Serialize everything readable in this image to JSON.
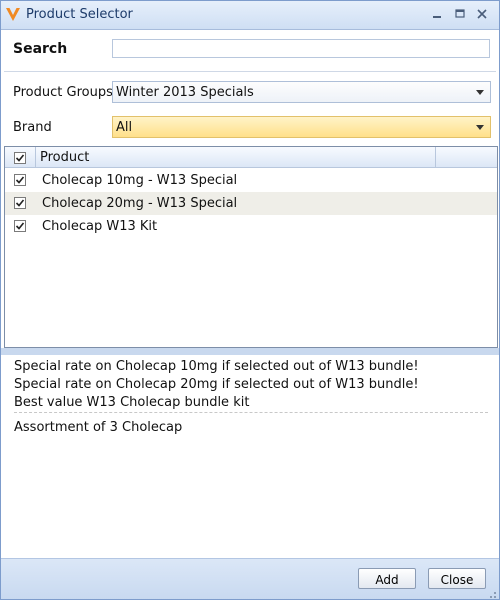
{
  "window": {
    "title": "Product Selector",
    "minimize_icon": "minimize-icon",
    "maximize_icon": "maximize-icon",
    "close_icon": "close-icon"
  },
  "search": {
    "label": "Search",
    "value": "",
    "placeholder": ""
  },
  "filters": {
    "product_groups": {
      "label": "Product Groups",
      "value": "Winter 2013 Specials"
    },
    "brand": {
      "label": "Brand",
      "value": "All"
    }
  },
  "grid": {
    "header": {
      "column_product": "Product",
      "all_checked": true
    },
    "rows": [
      {
        "label": "Cholecap 10mg - W13 Special",
        "checked": true
      },
      {
        "label": "Cholecap 20mg - W13 Special",
        "checked": true
      },
      {
        "label": "Cholecap W13 Kit",
        "checked": true
      }
    ]
  },
  "description": {
    "lines": [
      "Special rate on Cholecap 10mg if selected out of W13 bundle!",
      "Special rate on Cholecap 20mg if selected out of W13 bundle!",
      "Best value W13 Cholecap bundle kit"
    ],
    "note": "Assortment of 3 Cholecap"
  },
  "footer": {
    "add_label": "Add",
    "close_label": "Close"
  },
  "colors": {
    "accent_orange": "#f08a24",
    "brand_highlight": "#ffe08a"
  }
}
